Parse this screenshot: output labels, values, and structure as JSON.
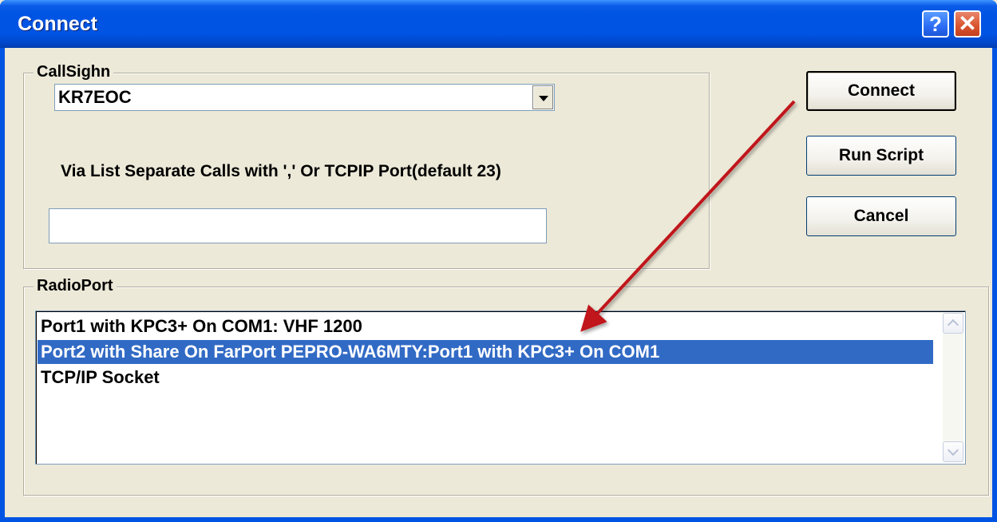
{
  "window": {
    "title": "Connect",
    "help_glyph": "?",
    "close_glyph": "✕"
  },
  "callsign": {
    "group_label": "CallSighn",
    "selected_value": "KR7EOC",
    "via_label": "Via List Separate Calls with ',' Or TCPIP Port(default 23)",
    "via_value": ""
  },
  "buttons": {
    "connect": "Connect",
    "run_script": "Run Script",
    "cancel": "Cancel"
  },
  "radioport": {
    "group_label": "RadioPort",
    "items": [
      {
        "label": "Port1 with KPC3+ On COM1: VHF 1200",
        "selected": false
      },
      {
        "label": "Port2 with Share On FarPort PEPRO-WA6MTY:Port1 with KPC3+ On COM1",
        "selected": true
      },
      {
        "label": "TCP/IP Socket",
        "selected": false
      }
    ]
  },
  "colors": {
    "selection": "#316ac5",
    "annotation_arrow": "#c0181a",
    "title_bar": "#0054e3"
  }
}
